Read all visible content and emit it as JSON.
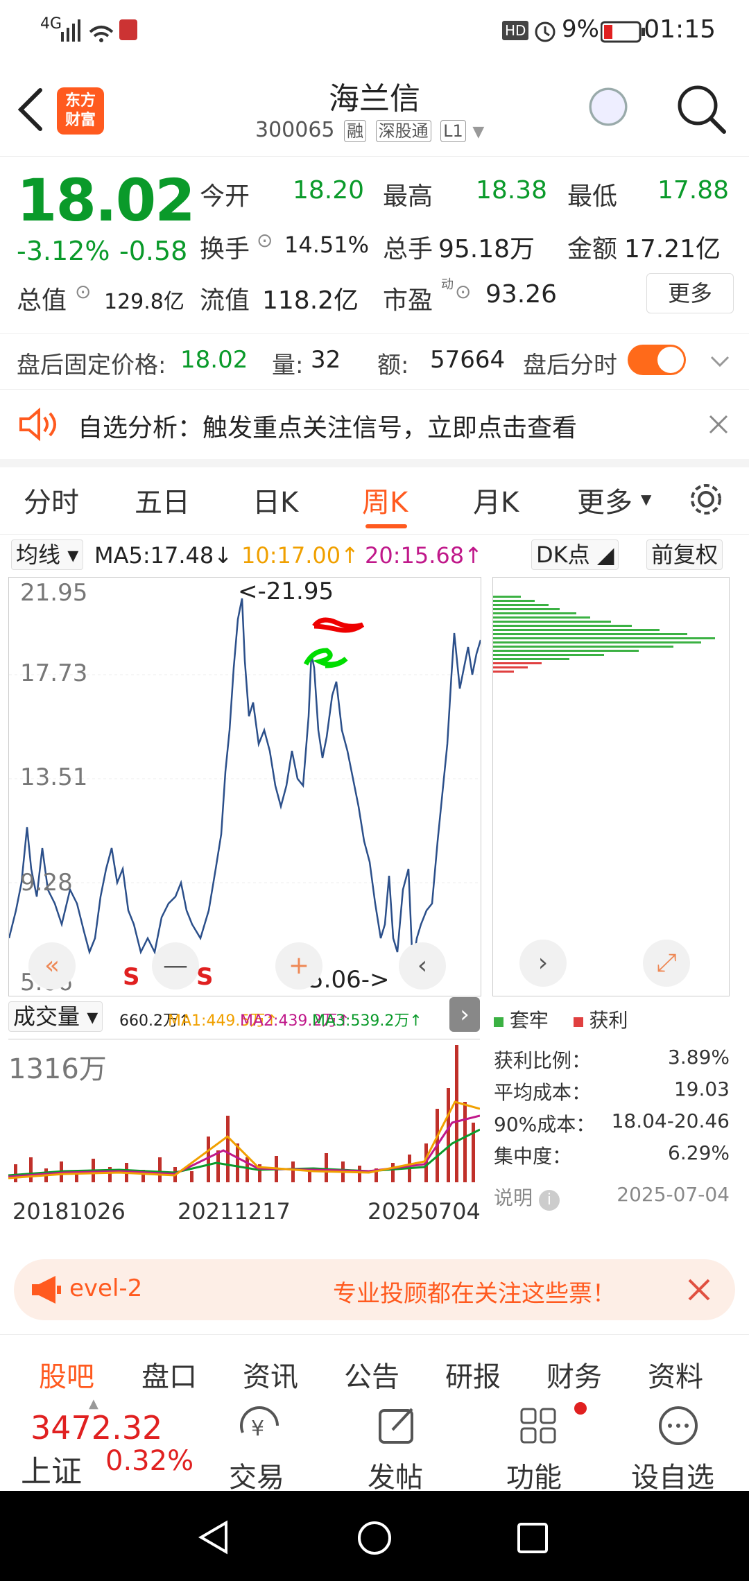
{
  "status_bar": {
    "network": "4G",
    "battery": "9%",
    "time": "01:15",
    "hd": "HD"
  },
  "header": {
    "logo_text": "东方\n财富",
    "stock_name": "海兰信",
    "stock_code": "300065",
    "tags": [
      "融",
      "深股通",
      "L1"
    ]
  },
  "quote": {
    "price": "18.02",
    "change_pct": "-3.12%",
    "change": "-0.58",
    "open_label": "今开",
    "open": "18.20",
    "high_label": "最高",
    "high": "18.38",
    "low_label": "最低",
    "low": "17.88",
    "turnover_label": "换手",
    "turnover": "14.51%",
    "volume_label": "总手",
    "volume": "95.18万",
    "amount_label": "金额",
    "amount": "17.21亿",
    "mcap_label": "总值",
    "mcap": "129.8亿",
    "float_label": "流值",
    "float_val": "118.2亿",
    "pe_label": "市盈",
    "pe_sup": "动",
    "pe": "93.26",
    "more": "更多"
  },
  "after_hours": {
    "price_label": "盘后固定价格:",
    "price": "18.02",
    "qty_label": "量:",
    "qty": "32",
    "amt_label": "额:",
    "amt": "57664",
    "toggle_label": "盘后分时"
  },
  "banner": {
    "text": "自选分析：触发重点关注信号，立即点击查看"
  },
  "tabs": [
    "分时",
    "五日",
    "日K",
    "周K",
    "月K",
    "更多"
  ],
  "active_tab": "周K",
  "ma": {
    "type": "均线",
    "ma5": "MA5:17.48↓",
    "ma10": "10:17.00↑",
    "ma20": "20:15.68↑",
    "dk": "DK点",
    "adjust": "前复权",
    "colors": {
      "ma5": "#222222",
      "ma10": "#f0a000",
      "ma20": "#c0188a"
    }
  },
  "kchart": {
    "y_labels": [
      "21.95",
      "17.73",
      "13.51",
      "9.28",
      "5.06"
    ],
    "max_annotation": "<-21.95",
    "min_annotation": "5.06->",
    "signals": [
      "S",
      "S",
      "S"
    ],
    "line_color": "#2b4f8a"
  },
  "volume": {
    "type": "成交量",
    "vol": "660.2万↑",
    "ma1": "MA1:449.5万↑",
    "ma2": "MA2:439.2万↑",
    "ma3": "MA3:539.2万↑",
    "max": "1316万",
    "dates": [
      "20181026",
      "20211217",
      "20250704"
    ]
  },
  "chip": {
    "legend_trapped": "套牢",
    "legend_profit": "获利",
    "stats": [
      {
        "label": "获利比例：",
        "value": "3.89%"
      },
      {
        "label": "平均成本：",
        "value": "19.03"
      },
      {
        "label": "90%成本：",
        "value": "18.04-20.46"
      },
      {
        "label": "集中度：",
        "value": "6.29%"
      }
    ],
    "note": "说明",
    "date": "2025-07-04"
  },
  "promo": {
    "level": "evel-2",
    "message": "专业投顾都在关注这些票！"
  },
  "sub_tabs": [
    "股吧",
    "盘口",
    "资讯",
    "公告",
    "研报",
    "财务",
    "资料"
  ],
  "footer": {
    "index_value": "3472.32",
    "index_name": "上证",
    "index_pct": "0.32%",
    "items": [
      "交易",
      "发帖",
      "功能",
      "设自选"
    ]
  }
}
